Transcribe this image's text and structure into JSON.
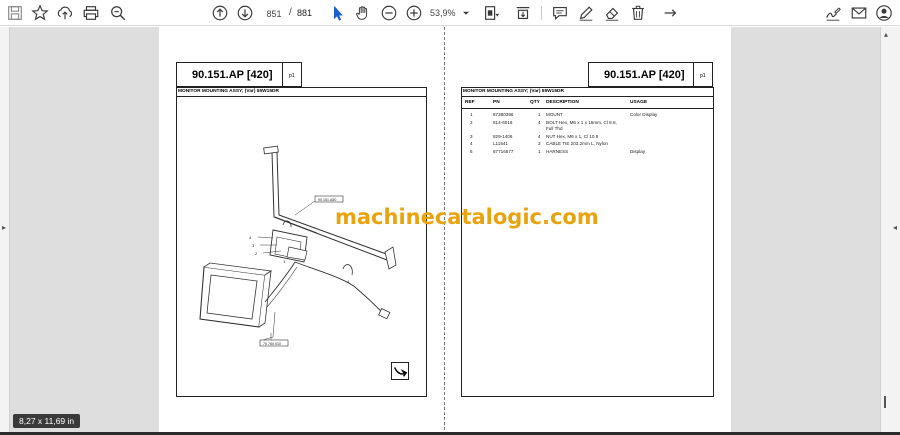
{
  "toolbar": {
    "current_page": "851",
    "page_separator": "/",
    "total_pages": "881",
    "zoom": "53,9%"
  },
  "page_size_label": "8,27 x 11,69 in",
  "left_page": {
    "code": "90.151.AP [420]",
    "sheet": "p1",
    "frame_title": "MONITOR MOUNTING ASSY; (Var) 55W15DR",
    "callouts": {
      "top": "90.151.A50",
      "bottom": "70.760.010"
    }
  },
  "right_page": {
    "code": "90.151.AP [420]",
    "sheet": "p1",
    "frame_title": "MONITOR MOUNTING ASSY; (Var) 55W15DR",
    "columns": [
      "REF",
      "PN",
      "QTY",
      "DESCRIPTION",
      "USAGE"
    ],
    "rows": [
      {
        "ref": "1",
        "pn": "87380396",
        "qty": "1",
        "desc": "MOUNT",
        "desc2": "",
        "usage": "Color Display"
      },
      {
        "ref": "2",
        "pn": "814-6016",
        "qty": "4",
        "desc": "BOLT Hex, M6 x 1 x 16mm, Cl 8.8,",
        "desc2": "Full Thd",
        "usage": ""
      },
      {
        "ref": "3",
        "pn": "829-1406",
        "qty": "4",
        "desc": "NUT Hex, M6 x 1, Cl 10.9",
        "desc2": "",
        "usage": ""
      },
      {
        "ref": "4",
        "pn": "L11541",
        "qty": "3",
        "desc": "CABLE TIE 203.2mm L, Nylon",
        "desc2": "",
        "usage": ""
      },
      {
        "ref": "5",
        "pn": "87716577",
        "qty": "1",
        "desc": "HARNESS",
        "desc2": "",
        "usage": "Display"
      }
    ]
  },
  "watermark": "machinecatalogic.com",
  "icons": {
    "save": "save-icon",
    "bookmark": "star-icon",
    "upload": "upload-icon",
    "print": "print-icon",
    "zoom": "zoom-icon",
    "prev": "arrow-up-icon",
    "next": "arrow-down-icon",
    "select": "cursor-icon",
    "hand": "hand-icon",
    "zoom_out": "minus-icon",
    "zoom_in": "plus-icon",
    "fit": "fit-page-icon",
    "scroll": "scroll-mode-icon",
    "comment": "comment-icon",
    "draw": "pen-icon",
    "erase": "eraser-icon",
    "delete": "trash-icon",
    "attach": "attach-icon",
    "sign": "sign-icon",
    "mail": "mail-icon",
    "account": "account-icon"
  }
}
